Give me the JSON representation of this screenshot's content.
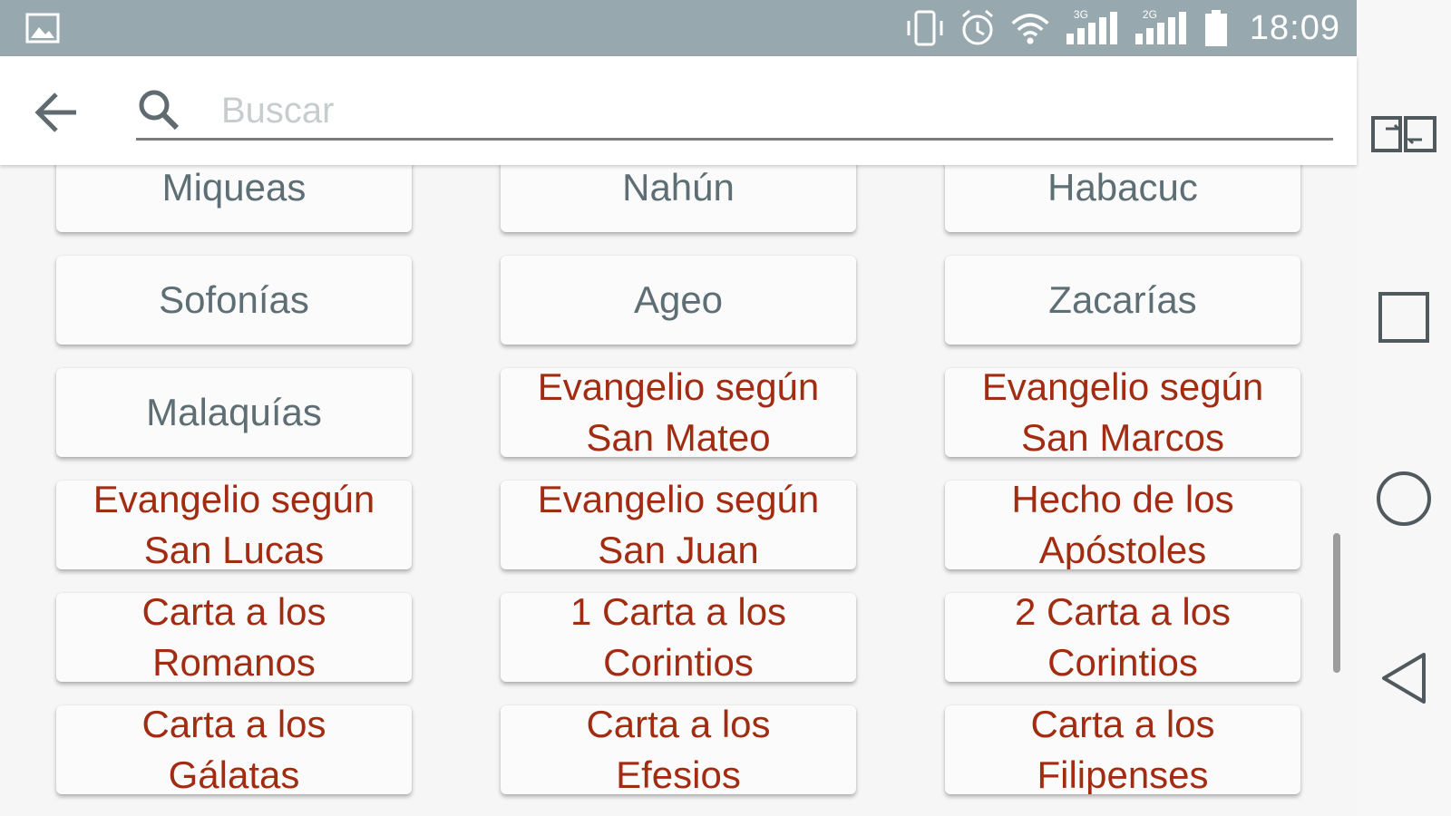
{
  "status_bar": {
    "time": "18:09",
    "network_1": "3G",
    "network_2": "2G",
    "icons": [
      "gallery-notification-icon",
      "vibrate-icon",
      "alarm-icon",
      "wifi-icon",
      "signal-icon",
      "signal-icon",
      "battery-icon"
    ]
  },
  "search": {
    "placeholder": "Buscar",
    "value": ""
  },
  "colors": {
    "status_bar": "#97a8ae",
    "old_testament_text": "#5d6e74",
    "new_testament_text": "#a12c12",
    "button_bg": "#fbfbfb"
  },
  "books": [
    {
      "line1": "Miqueas",
      "line2": "",
      "testament": "ot"
    },
    {
      "line1": "Nahún",
      "line2": "",
      "testament": "ot"
    },
    {
      "line1": "Habacuc",
      "line2": "",
      "testament": "ot"
    },
    {
      "line1": "Sofonías",
      "line2": "",
      "testament": "ot"
    },
    {
      "line1": "Ageo",
      "line2": "",
      "testament": "ot"
    },
    {
      "line1": "Zacarías",
      "line2": "",
      "testament": "ot"
    },
    {
      "line1": "Malaquías",
      "line2": "",
      "testament": "ot"
    },
    {
      "line1": "Evangelio según",
      "line2": "San Mateo",
      "testament": "nt"
    },
    {
      "line1": "Evangelio según",
      "line2": "San Marcos",
      "testament": "nt"
    },
    {
      "line1": "Evangelio según",
      "line2": "San Lucas",
      "testament": "nt"
    },
    {
      "line1": "Evangelio según",
      "line2": "San Juan",
      "testament": "nt"
    },
    {
      "line1": "Hecho de los",
      "line2": "Apóstoles",
      "testament": "nt"
    },
    {
      "line1": "Carta a los",
      "line2": "Romanos",
      "testament": "nt"
    },
    {
      "line1": "1 Carta a los",
      "line2": "Corintios",
      "testament": "nt"
    },
    {
      "line1": "2 Carta a los",
      "line2": "Corintios",
      "testament": "nt"
    },
    {
      "line1": "Carta a los",
      "line2": "Gálatas",
      "testament": "nt"
    },
    {
      "line1": "Carta a los",
      "line2": "Efesios",
      "testament": "nt"
    },
    {
      "line1": "Carta a los",
      "line2": "Filipenses",
      "testament": "nt"
    }
  ],
  "nav_bar": {
    "icons": [
      "swap-screen-icon",
      "recents-icon",
      "home-icon",
      "back-icon"
    ]
  }
}
